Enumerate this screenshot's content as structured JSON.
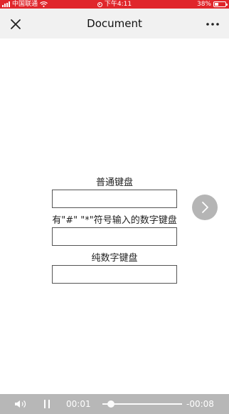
{
  "status_bar": {
    "carrier": "中国联通",
    "time": "下午4:11",
    "battery": "38%",
    "battery_level": 0.38,
    "bg_color": "#e0262b"
  },
  "nav": {
    "title": "Document",
    "close_icon": "close-icon",
    "more_icon": "more-icon",
    "bg_color": "#f1f1f1"
  },
  "form": {
    "fields": [
      {
        "label": "普通键盘",
        "value": "",
        "placeholder": ""
      },
      {
        "label": "有\"#\" \"*\"符号输入的数字键盘",
        "value": "",
        "placeholder": ""
      },
      {
        "label": "纯数字键盘",
        "value": "",
        "placeholder": ""
      }
    ]
  },
  "floating_button": {
    "icon": "chevron-right-icon",
    "color": "#b5b5b5"
  },
  "media_bar": {
    "current_time": "00:01",
    "remaining_time": "-00:08",
    "progress": 0.11,
    "speaker_icon": "speaker-icon",
    "pause_icon": "pause-icon",
    "bg_color": "#b7b7b7"
  }
}
